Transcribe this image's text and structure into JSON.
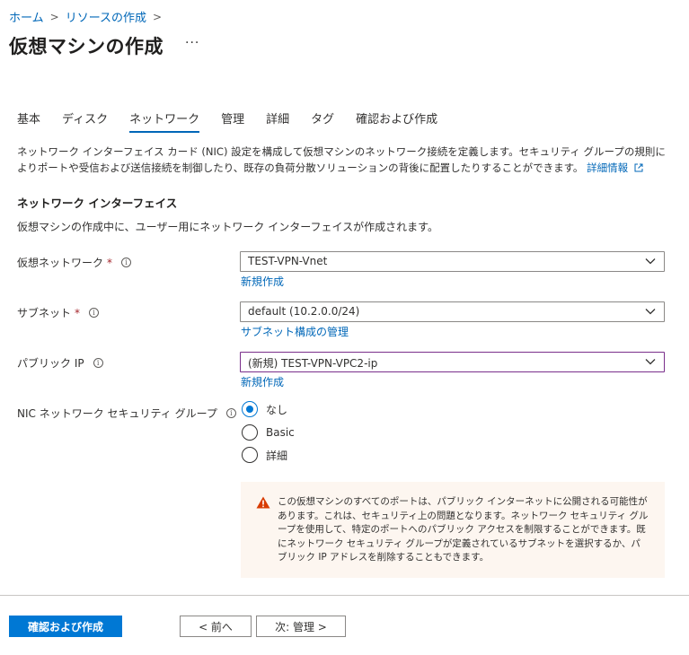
{
  "breadcrumb": {
    "items": [
      "ホーム",
      "リソースの作成"
    ],
    "separator": ">"
  },
  "page": {
    "title": "仮想マシンの作成",
    "more_label": "···"
  },
  "tabs": [
    {
      "label": "基本",
      "active": false
    },
    {
      "label": "ディスク",
      "active": false
    },
    {
      "label": "ネットワーク",
      "active": true
    },
    {
      "label": "管理",
      "active": false
    },
    {
      "label": "詳細",
      "active": false
    },
    {
      "label": "タグ",
      "active": false
    },
    {
      "label": "確認および作成",
      "active": false
    }
  ],
  "description": {
    "text": "ネットワーク インターフェイス カード (NIC) 設定を構成して仮想マシンのネットワーク接続を定義します。セキュリティ グループの規則によりポートや受信および送信接続を制御したり、既存の負荷分散ソリューションの背後に配置したりすることができます。",
    "learn_more": "詳細情報"
  },
  "section": {
    "title": "ネットワーク インターフェイス",
    "description": "仮想マシンの作成中に、ユーザー用にネットワーク インターフェイスが作成されます。"
  },
  "fields": {
    "vnet": {
      "label": "仮想ネットワーク",
      "required": "*",
      "value": "TEST-VPN-Vnet",
      "link": "新規作成"
    },
    "subnet": {
      "label": "サブネット",
      "required": "*",
      "value": "default (10.2.0.0/24)",
      "link": "サブネット構成の管理"
    },
    "public_ip": {
      "label": "パブリック IP",
      "value": "(新規) TEST-VPN-VPC2-ip",
      "link": "新規作成"
    },
    "nsg": {
      "label": "NIC ネットワーク セキュリティ グループ",
      "options": [
        "なし",
        "Basic",
        "詳細"
      ],
      "selected": "なし"
    }
  },
  "warning": {
    "text": "この仮想マシンのすべてのポートは、パブリック インターネットに公開される可能性があります。これは、セキュリティ上の問題となります。ネットワーク セキュリティ グループを使用して、特定のポートへのパブリック アクセスを制限することができます。既にネットワーク セキュリティ グループが定義されているサブネットを選択するか、パブリック IP アドレスを削除することもできます。",
    "icon": "warning-icon",
    "icon_color": "#d83b01"
  },
  "footer": {
    "review_create": "確認および作成",
    "prev": "< 前へ",
    "next": "次: 管理 >"
  },
  "colors": {
    "accent": "#0078d4",
    "link": "#0067b8",
    "required": "#a4262c",
    "focus_border": "#7a2f8b",
    "warning_bg": "#fdf6f0"
  }
}
